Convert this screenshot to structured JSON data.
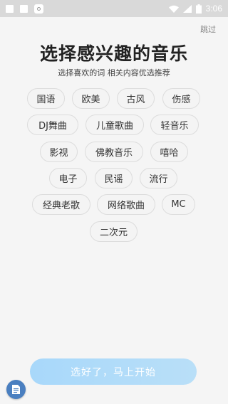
{
  "status_bar": {
    "time": "3:06"
  },
  "header": {
    "skip_label": "跳过",
    "title": "选择感兴趣的音乐",
    "subtitle": "选择喜欢的词 相关内容优选推荐"
  },
  "tags": [
    "国语",
    "欧美",
    "古风",
    "伤感",
    "DJ舞曲",
    "儿童歌曲",
    "轻音乐",
    "影视",
    "佛教音乐",
    "嘻哈",
    "电子",
    "民谣",
    "流行",
    "经典老歌",
    "网络歌曲",
    "MC",
    "二次元"
  ],
  "footer": {
    "confirm_label": "选好了，马上开始"
  },
  "colors": {
    "accent": "#a8d8fa",
    "fab": "#4a7fc0"
  },
  "icons": {
    "fab": "document-icon"
  }
}
